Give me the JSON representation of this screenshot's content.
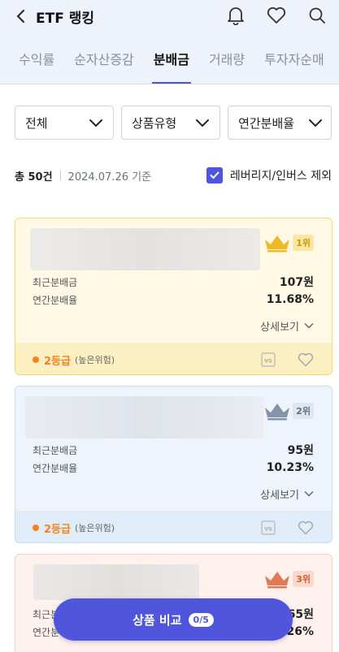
{
  "header": {
    "title": "ETF 랭킹"
  },
  "tabs": [
    {
      "label": "수익률",
      "active": false
    },
    {
      "label": "순자산증감",
      "active": false
    },
    {
      "label": "분배금",
      "active": true
    },
    {
      "label": "거래량",
      "active": false
    },
    {
      "label": "투자자순매",
      "active": false
    }
  ],
  "filters": {
    "all": "전체",
    "type": "상품유형",
    "rate": "연간분배율"
  },
  "summary": {
    "count": "총 50건",
    "date": "2024.07.26 기준",
    "exclude_label": "레버리지/인버스 제외"
  },
  "cards": [
    {
      "rank": "1위",
      "recent_label": "최근분배금",
      "recent_value": "107원",
      "annual_label": "연간분배율",
      "annual_value": "11.68%",
      "more": "상세보기",
      "grade": "2등급",
      "risk": "(높은위험)",
      "vs": "VS"
    },
    {
      "rank": "2위",
      "recent_label": "최근분배금",
      "recent_value": "95원",
      "annual_label": "연간분배율",
      "annual_value": "10.23%",
      "more": "상세보기",
      "grade": "2등급",
      "risk": "(높은위험)",
      "vs": "VS"
    },
    {
      "rank": "3위",
      "recent_label": "최근분배금",
      "recent_value": "65원",
      "annual_label": "연간분배율",
      "annual_value": "26%"
    }
  ],
  "compare": {
    "label": "상품 비교",
    "count": "0/5"
  },
  "colors": {
    "accent": "#4f56db",
    "gold": "#f0b823",
    "silver": "#8593a8",
    "bronze": "#e07a55",
    "grade": "#f5821f"
  }
}
